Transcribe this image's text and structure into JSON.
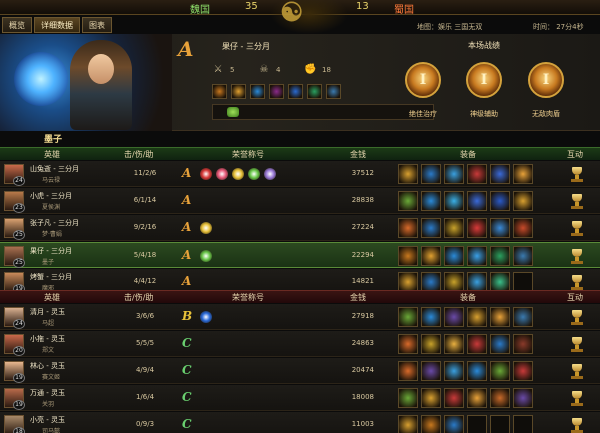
{
  "topbar": {
    "left_team": "魏国",
    "left_score": "35",
    "right_score": "13",
    "right_team": "蜀国"
  },
  "tabs": [
    {
      "label": "概览"
    },
    {
      "label": "详细数据"
    },
    {
      "label": "图表"
    }
  ],
  "info": {
    "map": "地图：娱乐 三国无双",
    "time": "时间：  27分4秒"
  },
  "hero_panel": {
    "grade": "A",
    "player_name": "果仔 - 三分月",
    "kills": "5",
    "deaths": "4",
    "assists": "18",
    "equipment_colors": [
      "#c8781e",
      "#e0a030",
      "#2a8ad8",
      "#8a2a8a",
      "#2a6ad0",
      "#2aa060",
      "#3a7ab0"
    ],
    "battle_title": "本场战绩",
    "medals": [
      {
        "glyph": "I",
        "label": "绝佳治疗"
      },
      {
        "glyph": "I",
        "label": "神级辅助"
      },
      {
        "glyph": "I",
        "label": "无敌肉盾"
      }
    ]
  },
  "section_label": "墨子",
  "team1_header": {
    "hero": "英雄",
    "kda": "击/伤/助",
    "honor": "荣誉称号",
    "gold": "金钱",
    "equip": "装备",
    "interact": "互动"
  },
  "team1": [
    {
      "name": "山兔逝 - 三分月",
      "level": "24",
      "hero": "马云禄",
      "kda": "11/2/6",
      "grade": "A",
      "gold": "37512",
      "honors": [
        "#d83a3a",
        "#e85a7a",
        "#e8c23a",
        "#6ac84a",
        "#9a7ad8"
      ],
      "equip": [
        "#d8a030",
        "#2a7ac8",
        "#3aa0e0",
        "#c83a3a",
        "#3a6ad8",
        "#e8a23a"
      ],
      "avatar": "#c86a4a"
    },
    {
      "name": "小虎 - 三分月",
      "level": "23",
      "hero": "夏侯渊",
      "kda": "6/1/14",
      "grade": "A",
      "gold": "28838",
      "honors": [],
      "equip": [
        "#6aa838",
        "#2a8ad8",
        "#3ab0e8",
        "#3a6ad8",
        "#2a5ac8",
        "#d8a030"
      ],
      "avatar": "#b87a4a"
    },
    {
      "name": "张子凡 - 三分月",
      "level": "25",
      "hero": "梦·曹娟",
      "kda": "9/2/16",
      "grade": "A",
      "gold": "27224",
      "honors": [
        "#e8c23a"
      ],
      "equip": [
        "#d86a2a",
        "#2a7ac8",
        "#c8a22a",
        "#d83a3a",
        "#3a8ad8",
        "#c84a2a"
      ],
      "avatar": "#d8a070"
    },
    {
      "name": "果仔 - 三分月",
      "level": "25",
      "hero": "墨子",
      "kda": "5/4/18",
      "grade": "A",
      "gold": "22294",
      "honors": [
        "#6ac84a"
      ],
      "equip": [
        "#c8781e",
        "#e0a030",
        "#2a8ad8",
        "#3aa0e8",
        "#2aa060",
        "#3a7ab0"
      ],
      "avatar": "#a87050",
      "self": true
    },
    {
      "name": "烤蟹 - 三分月",
      "level": "19",
      "hero": "魔邪",
      "kda": "4/4/12",
      "grade": "A",
      "gold": "14821",
      "honors": [],
      "equip": [
        "#d8a030",
        "#2a7ac8",
        "#c8a22a",
        "#3aa0e0",
        "#3ac08a",
        "#1a1a1a"
      ],
      "avatar": "#c88a5a"
    }
  ],
  "team2_header": {
    "hero": "英雄",
    "kda": "击/伤/助",
    "honor": "荣誉称号",
    "gold": "金钱",
    "equip": "装备",
    "interact": "互动"
  },
  "team2": [
    {
      "name": "清月 - 灵玉",
      "level": "24",
      "hero": "马超",
      "kda": "3/6/6",
      "grade": "B",
      "gold": "27918",
      "honors": [
        "#2a6ad8"
      ],
      "equip": [
        "#6aa838",
        "#2a8ad8",
        "#6a4aa8",
        "#d8a030",
        "#e8a23a",
        "#3a7ab0"
      ],
      "avatar": "#d8b090"
    },
    {
      "name": "小拖 - 灵玉",
      "level": "20",
      "hero": "郑文",
      "kda": "5/5/5",
      "grade": "C",
      "gold": "24863",
      "honors": [],
      "equip": [
        "#d86a2a",
        "#c8a22a",
        "#e8b040",
        "#c83a3a",
        "#2a7ac8",
        "#8a3a2a"
      ],
      "avatar": "#c8684a"
    },
    {
      "name": "林心 - 灵玉",
      "level": "19",
      "hero": "赛文姬",
      "kda": "4/9/4",
      "grade": "C",
      "gold": "20474",
      "honors": [],
      "equip": [
        "#d86a2a",
        "#6a4aa8",
        "#3aa0e0",
        "#2a8ad8",
        "#6aa838",
        "#c83a3a"
      ],
      "avatar": "#e8b890"
    },
    {
      "name": "万通 - 灵玉",
      "level": "19",
      "hero": "关羽",
      "kda": "1/6/4",
      "grade": "C",
      "gold": "18008",
      "honors": [],
      "equip": [
        "#6aa838",
        "#d8a030",
        "#c83a3a",
        "#e8a23a",
        "#c86a2a",
        "#6a4aa8"
      ],
      "avatar": "#b86a4a"
    },
    {
      "name": "小亮 - 灵玉",
      "level": "18",
      "hero": "司马懿",
      "kda": "0/9/3",
      "grade": "C",
      "gold": "11003",
      "honors": [],
      "equip": [
        "#d8a030",
        "#c8781e",
        "#2a7ac8",
        "#1a1a1a",
        "#1a1a1a",
        "#1a1a1a"
      ],
      "avatar": "#a88a6a"
    }
  ]
}
